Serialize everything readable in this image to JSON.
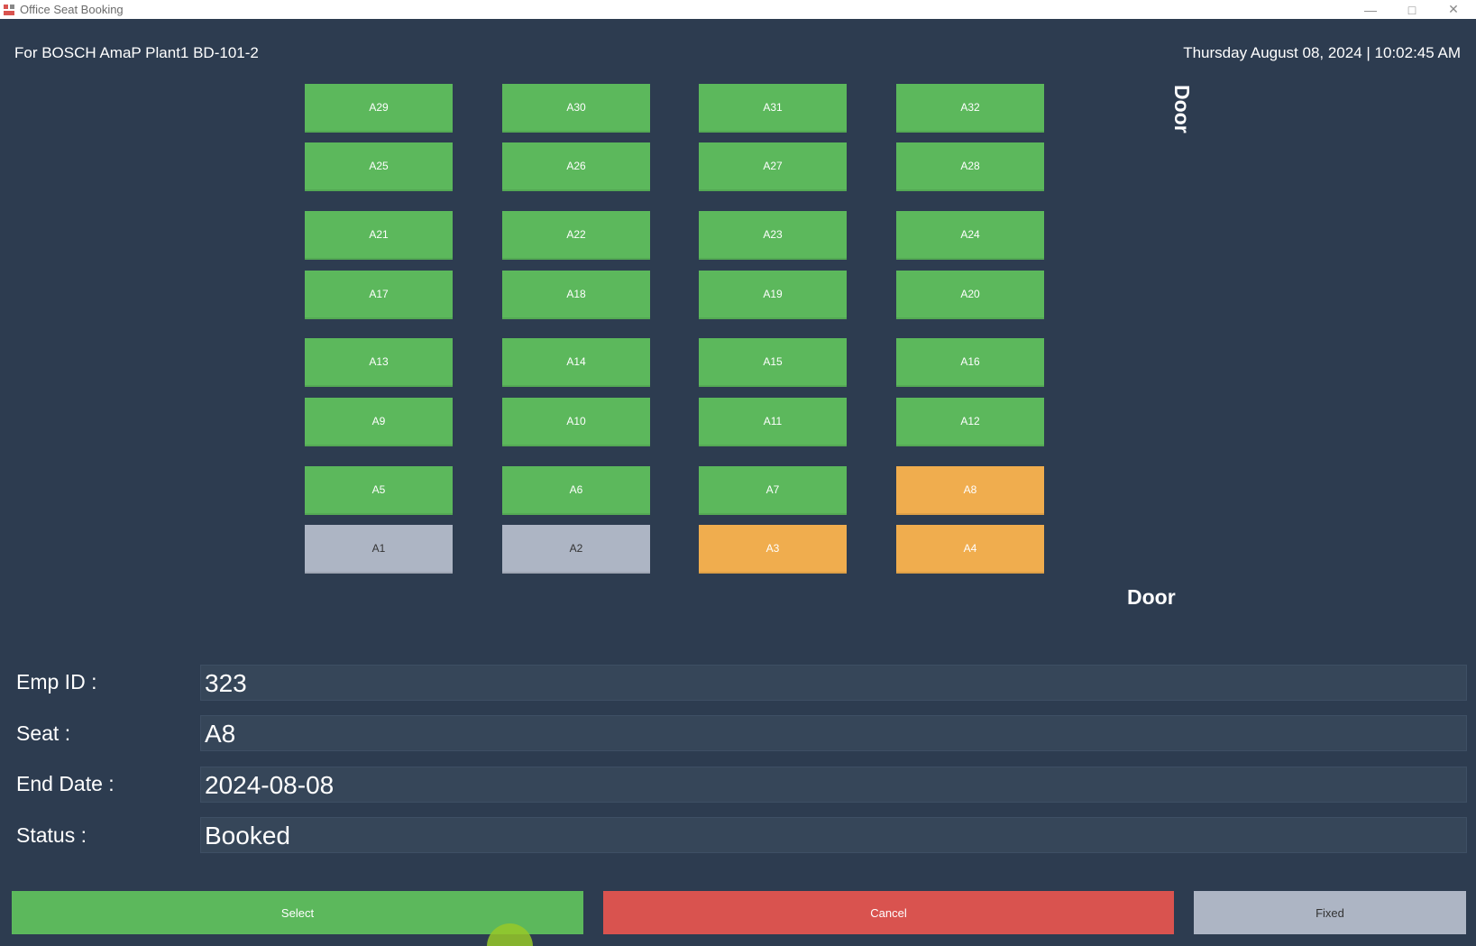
{
  "window": {
    "title": "Office Seat Booking",
    "controls": [
      "minimize",
      "maximize",
      "close"
    ]
  },
  "header": {
    "location": "For BOSCH AmaP Plant1 BD-101-2",
    "datetime": "Thursday August 08, 2024 | 10:02:45 AM"
  },
  "colors": {
    "available": "#5cb85c",
    "booked": "#f0ad4e",
    "fixed": "#adb5c4",
    "cancel": "#d9534f",
    "background": "#2d3c50"
  },
  "seats": [
    {
      "label": "A29",
      "status": "available"
    },
    {
      "label": "A30",
      "status": "available"
    },
    {
      "label": "A31",
      "status": "available"
    },
    {
      "label": "A32",
      "status": "available"
    },
    {
      "label": "A25",
      "status": "available"
    },
    {
      "label": "A26",
      "status": "available"
    },
    {
      "label": "A27",
      "status": "available"
    },
    {
      "label": "A28",
      "status": "available"
    },
    {
      "label": "A21",
      "status": "available"
    },
    {
      "label": "A22",
      "status": "available"
    },
    {
      "label": "A23",
      "status": "available"
    },
    {
      "label": "A24",
      "status": "available"
    },
    {
      "label": "A17",
      "status": "available"
    },
    {
      "label": "A18",
      "status": "available"
    },
    {
      "label": "A19",
      "status": "available"
    },
    {
      "label": "A20",
      "status": "available"
    },
    {
      "label": "A13",
      "status": "available"
    },
    {
      "label": "A14",
      "status": "available"
    },
    {
      "label": "A15",
      "status": "available"
    },
    {
      "label": "A16",
      "status": "available"
    },
    {
      "label": "A9",
      "status": "available"
    },
    {
      "label": "A10",
      "status": "available"
    },
    {
      "label": "A11",
      "status": "available"
    },
    {
      "label": "A12",
      "status": "available"
    },
    {
      "label": "A5",
      "status": "available"
    },
    {
      "label": "A6",
      "status": "available"
    },
    {
      "label": "A7",
      "status": "available"
    },
    {
      "label": "A8",
      "status": "booked"
    },
    {
      "label": "A1",
      "status": "fixed"
    },
    {
      "label": "A2",
      "status": "fixed"
    },
    {
      "label": "A3",
      "status": "booked"
    },
    {
      "label": "A4",
      "status": "booked"
    }
  ],
  "doors": {
    "right": "Door",
    "bottom": "Door"
  },
  "form": {
    "emp_id_label": "Emp ID :",
    "emp_id_value": "323",
    "seat_label": "Seat :",
    "seat_value": "A8",
    "end_date_label": "End Date :",
    "end_date_value": "2024-08-08",
    "status_label": "Status :",
    "status_value": "Booked"
  },
  "actions": {
    "select": "Select",
    "cancel": "Cancel",
    "fixed": "Fixed"
  }
}
